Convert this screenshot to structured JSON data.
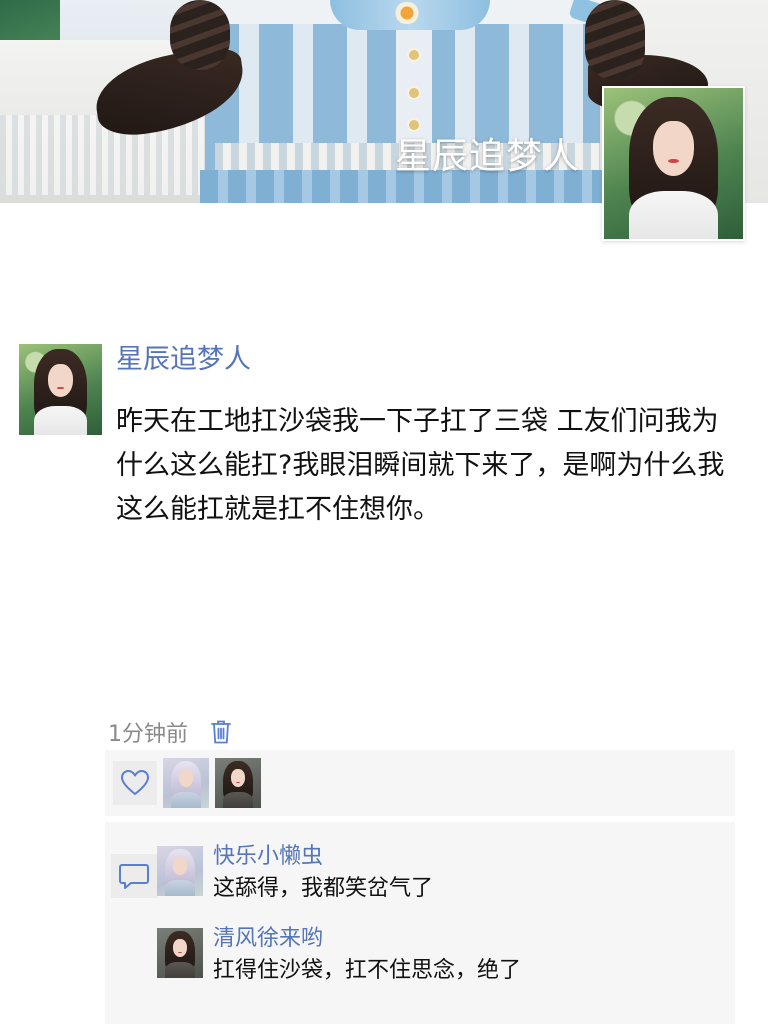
{
  "cover": {
    "display_name": "星辰追梦人"
  },
  "post": {
    "author": "星辰追梦人",
    "content": "昨天在工地扛沙袋我一下子扛了三袋 工友们问我为什么这么能扛?我眼泪瞬间就下来了，是啊为什么我这么能扛就是扛不住想你。",
    "time": "1分钟前"
  },
  "icons": {
    "delete": "trash-icon",
    "like": "heart-icon",
    "comment": "comment-bubble-icon"
  },
  "colors": {
    "name_link": "#5575b8",
    "panel_bg": "#f6f6f6",
    "icon_blue": "#5b7fd0",
    "meta_gray": "#8a8a8a"
  },
  "comments": [
    {
      "author": "快乐小懒虫",
      "text": "这舔得，我都笑岔气了"
    },
    {
      "author": "清风徐来哟",
      "text": "扛得住沙袋，扛不住思念，绝了"
    }
  ]
}
